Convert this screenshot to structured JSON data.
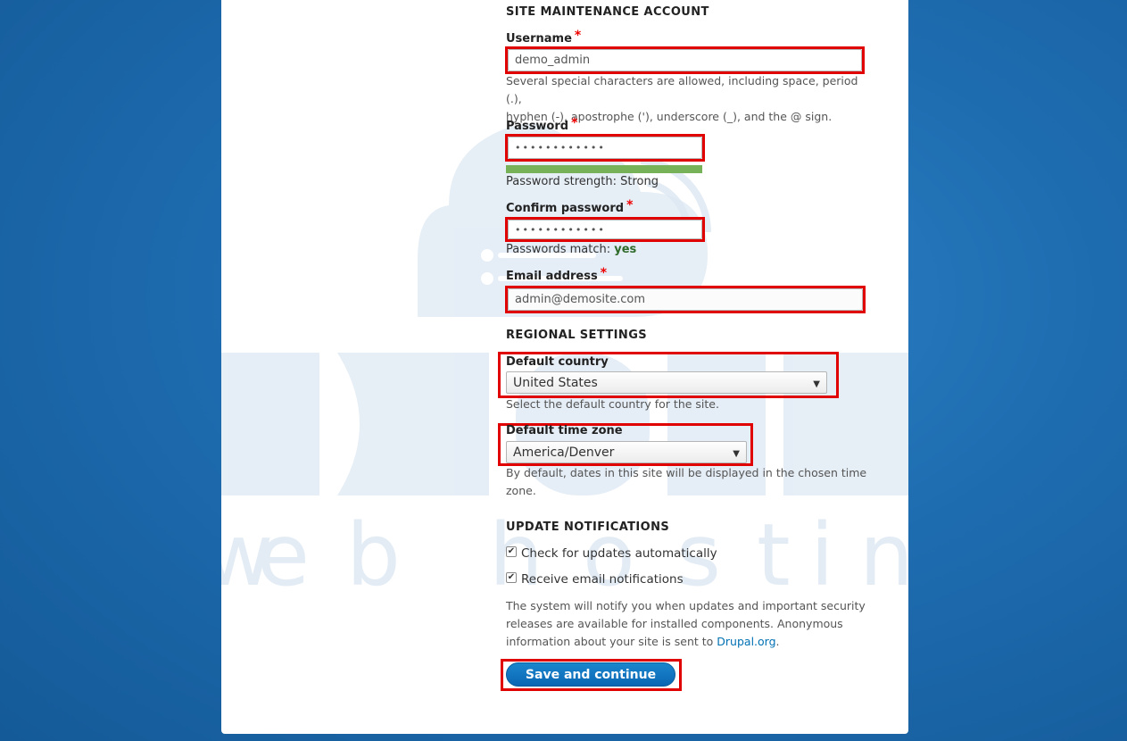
{
  "account": {
    "section_title": "SITE MAINTENANCE ACCOUNT",
    "username": {
      "label": "Username",
      "required_mark": "*",
      "value": "demo_admin",
      "help_line1": "Several special characters are allowed, including space, period (.),",
      "help_line2": "hyphen (-), apostrophe ('), underscore (_), and the @ sign."
    },
    "password": {
      "label": "Password",
      "required_mark": "*",
      "masked_value": "••••••••••••",
      "strength_label": "Password strength: Strong",
      "strength_fraction": 1.0
    },
    "confirm_password": {
      "label": "Confirm password",
      "required_mark": "*",
      "masked_value": "••••••••••••",
      "match_label": "Passwords match:",
      "match_value": "yes"
    },
    "email": {
      "label": "Email address",
      "required_mark": "*",
      "value": "admin@demosite.com"
    }
  },
  "regional": {
    "section_title": "REGIONAL SETTINGS",
    "country": {
      "label": "Default country",
      "value": "United States",
      "help": "Select the default country for the site."
    },
    "timezone": {
      "label": "Default time zone",
      "value": "America/Denver",
      "help_line1": "By default, dates in this site will be displayed in the chosen time",
      "help_line2": "zone."
    }
  },
  "updates": {
    "section_title": "UPDATE NOTIFICATIONS",
    "check_updates": {
      "label": "Check for updates automatically",
      "checked": true
    },
    "email_notifications": {
      "label": "Receive email notifications",
      "checked": true
    },
    "help_line1": "The system will notify you when updates and important security",
    "help_line2": "releases are available for installed components. Anonymous",
    "help_line3_prefix": "information about your site is sent to ",
    "help_link": "Drupal.org",
    "help_line3_suffix": "."
  },
  "submit": {
    "label": "Save and continue"
  },
  "colors": {
    "background": "#1e6cb0",
    "highlight": "#e00000",
    "accent": "#0071b3",
    "strength_bar": "#77b259",
    "required": "#ee0000"
  }
}
